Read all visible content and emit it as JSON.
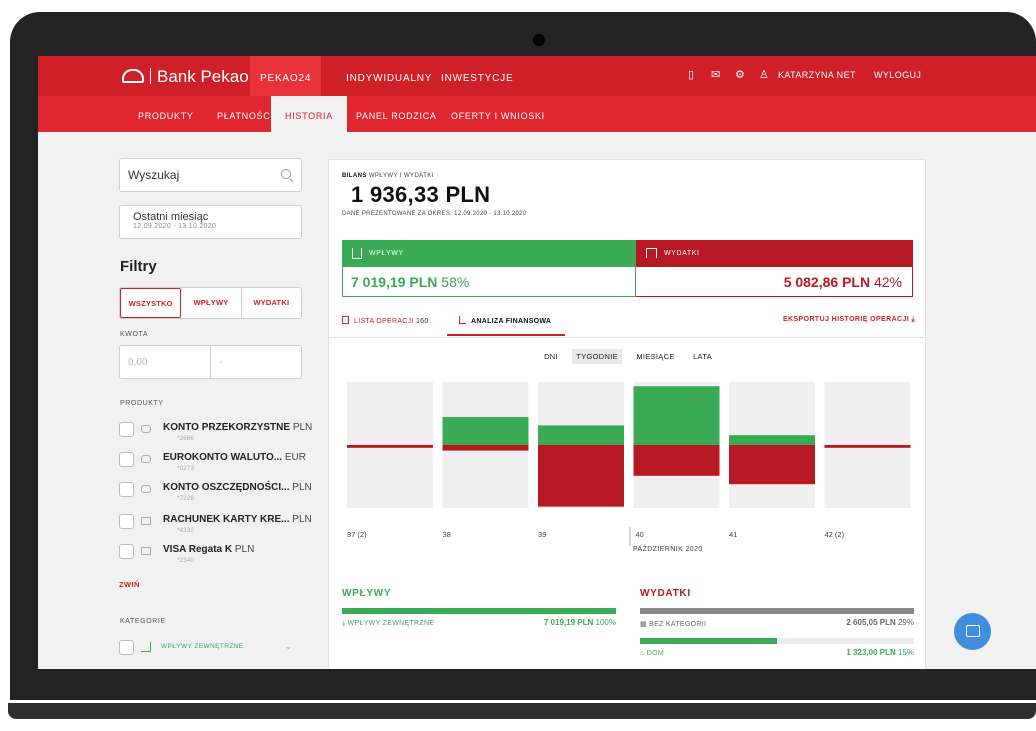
{
  "topnav": {
    "brand": "Bank Pekao",
    "tabs": [
      "PEKAO24",
      "INDYWIDUALNY",
      "INWESTYCJE"
    ],
    "user": "KATARZYNA NET",
    "logout": "WYLOGUJ"
  },
  "subnav": {
    "tabs": [
      "PRODUKTY",
      "PŁATNOŚCI",
      "HISTORIA",
      "PANEL RODZICA",
      "OFERTY I WNIOSKI"
    ],
    "active": "HISTORIA"
  },
  "sidebar": {
    "search_placeholder": "Wyszukaj",
    "period_title": "Ostatni miesiąc",
    "period_range": "12.09.2020 - 13.10.2020",
    "filters_title": "Filtry",
    "segments": [
      "WSZYSTKO",
      "WPŁYWY",
      "WYDATKI"
    ],
    "amount_label": "KWOTA",
    "amount_from_placeholder": "0,00",
    "amount_to_placeholder": "-",
    "products_label": "PRODUKTY",
    "products": [
      {
        "name": "KONTO PRZEKORZYSTNE",
        "currency": "PLN",
        "number": "*2666"
      },
      {
        "name": "EUROKONTO WALUTO...",
        "currency": "EUR",
        "number": "*0273"
      },
      {
        "name": "KONTO OSZCZĘDNOŚCI...",
        "currency": "PLN",
        "number": "*7228"
      },
      {
        "name": "RACHUNEK KARTY KRE...",
        "currency": "PLN",
        "number": "*4332"
      },
      {
        "name": "VISA Regata K",
        "currency": "PLN",
        "number": "*2340"
      }
    ],
    "collapse": "ZWIŃ",
    "categories_label": "KATEGORIE",
    "category_first": "WPŁYWY ZEWNĘTRZNE"
  },
  "balance": {
    "label_bold": "BILANS",
    "label_rest": "WPŁYWY I WYDATKI",
    "value": "1 936,33 PLN",
    "period": "DANE PREZENTOWANE ZA OKRES: 12.09.2020 - 13.10.2020"
  },
  "income": {
    "label": "WPŁYWY",
    "value": "7 019,19 PLN",
    "pct": "58%"
  },
  "expenses": {
    "label": "WYDATKI",
    "value": "5 082,86 PLN",
    "pct": "42%"
  },
  "tabs": {
    "list_label": "LISTA OPERACJI",
    "list_count": "160",
    "analysis_label": "ANALIZA FINANSOWA",
    "export": "EKSPORTUJ HISTORIĘ OPERACJI"
  },
  "period_buttons": [
    "DNI",
    "TYGODNIE",
    "MIESIĄCE",
    "LATA"
  ],
  "period_active": "TYGODNIE",
  "colors": {
    "income": "#3aaa55",
    "expense": "#b61923",
    "brand": "#cf2027"
  },
  "chart_data": {
    "type": "bar",
    "categories": [
      "37 (2)",
      "38",
      "39",
      "40",
      "41",
      "42 (2)"
    ],
    "month_label": "PAŹDZIERNIK 2020",
    "series": [
      {
        "name": "WPŁYWY",
        "values": [
          0,
          1.0,
          0.7,
          2.1,
          0.35,
          0
        ]
      },
      {
        "name": "WYDATKI",
        "values": [
          0.1,
          0.2,
          2.2,
          1.1,
          1.4,
          0.1
        ]
      }
    ]
  },
  "summary": {
    "income_title": "WPŁYWY",
    "income_rows": [
      {
        "label": "WPŁYWY ZEWNĘTRZNE",
        "value": "7 019,19 PLN",
        "pct": "100%",
        "fill": 1.0
      }
    ],
    "expense_title": "WYDATKI",
    "expense_rows": [
      {
        "label": "BEZ KATEGORII",
        "value": "2 605,05 PLN",
        "pct": "29%",
        "fill": 1.0
      },
      {
        "label": "DOM",
        "value": "1 323,00 PLN",
        "pct": "15%",
        "fill": 0.5
      }
    ]
  }
}
